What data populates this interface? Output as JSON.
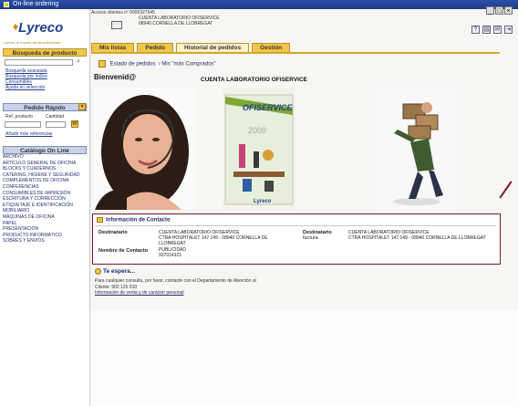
{
  "window": {
    "title": "On-line ordering"
  },
  "logo": {
    "brand": "Lyreco",
    "subtitle": "Lyreco, el mundo de las soluciones"
  },
  "account": {
    "code_label": "Acceso clientes  nº 0005327545",
    "name": "CUENTA LABORATORIO OFISERVICE",
    "address": "08940 CORNELLA DE LLOBREGAT"
  },
  "sidebar": {
    "search_header": "Búsqueda de producto",
    "search_links": [
      "Búsqueda avanzada",
      "Búsqueda por índice",
      "Consumibles",
      "Ayuda en selección"
    ],
    "quick_header": "Pedido Rápido",
    "quick_ref_label": "Ref. producto",
    "quick_qty_label": "Cantidad",
    "quick_add_link": "Añadir más referencias",
    "catalog_header": "Catálogo On Line",
    "catalog": [
      "ARCHIVO",
      "ARTÍCULO GENERAL DE OFICINA",
      "BLOCKS Y CUADERNOS",
      "CATERING, HIGIENE Y SEGURIDAD",
      "COMPLEMENTOS DE OFICINA",
      "CONFERENCIAS",
      "CONSUMIBLES DE IMPRESIÓN",
      "ESCRITURA Y CORRECCIÓN",
      "ETIQUETAJE E IDENTIFICACIÓN",
      "MOBILIARIO",
      "MÁQUINAS DE OFICINA",
      "PAPEL",
      "PRESENTACIÓN",
      "PRODUCTO INFORMÁTICO",
      "SOBRES Y ENVÍOS"
    ]
  },
  "tabs": [
    "Mis listas",
    "Pedido",
    "Historial de pedidos",
    "Gestión"
  ],
  "breadcrumb": {
    "a": "Estado de pedidos",
    "b": "Mis \"más Comprados\""
  },
  "main": {
    "welcome": "Bienvenid@",
    "account_title": "CUENTA LABORATORIO OFISERVICE",
    "catalog_brand": "OFISERVICE",
    "catalog_year": "2009",
    "catalog_footer": "Lyreco"
  },
  "contact": {
    "title": "Información de Contacto",
    "dest_label": "Destinatario",
    "dest_name": "CUENTA LABORATORIO OFISERVICE",
    "dest_addr1": "CTRA HOSPITALET 147 149 - 08940 CORNELLA DE",
    "dest_addr2": "LLOBREGAT",
    "contact_label": "Nombre de Contacto",
    "contact_name": "PUBLICIDAD",
    "contact_phone": "937014321",
    "invoice_label1": "Destinatario",
    "invoice_label2": "factura",
    "invoice_name": "CUENTA LABORATORIO OFISERVICE",
    "invoice_addr": "CTRA HOSPITALET 147 149 - 08940 CORNELLA DE LLOBREGAT"
  },
  "espera": {
    "title": "Te espera...",
    "line1": "Para cualquier consulta, por favor, contacte con el Departamento de Atención al",
    "line2": "Cliente: 902 120 010",
    "link": "Información de venta y de carácter personal"
  },
  "icons": [
    "help-icon",
    "print-icon",
    "mail-icon",
    "exit-icon"
  ]
}
